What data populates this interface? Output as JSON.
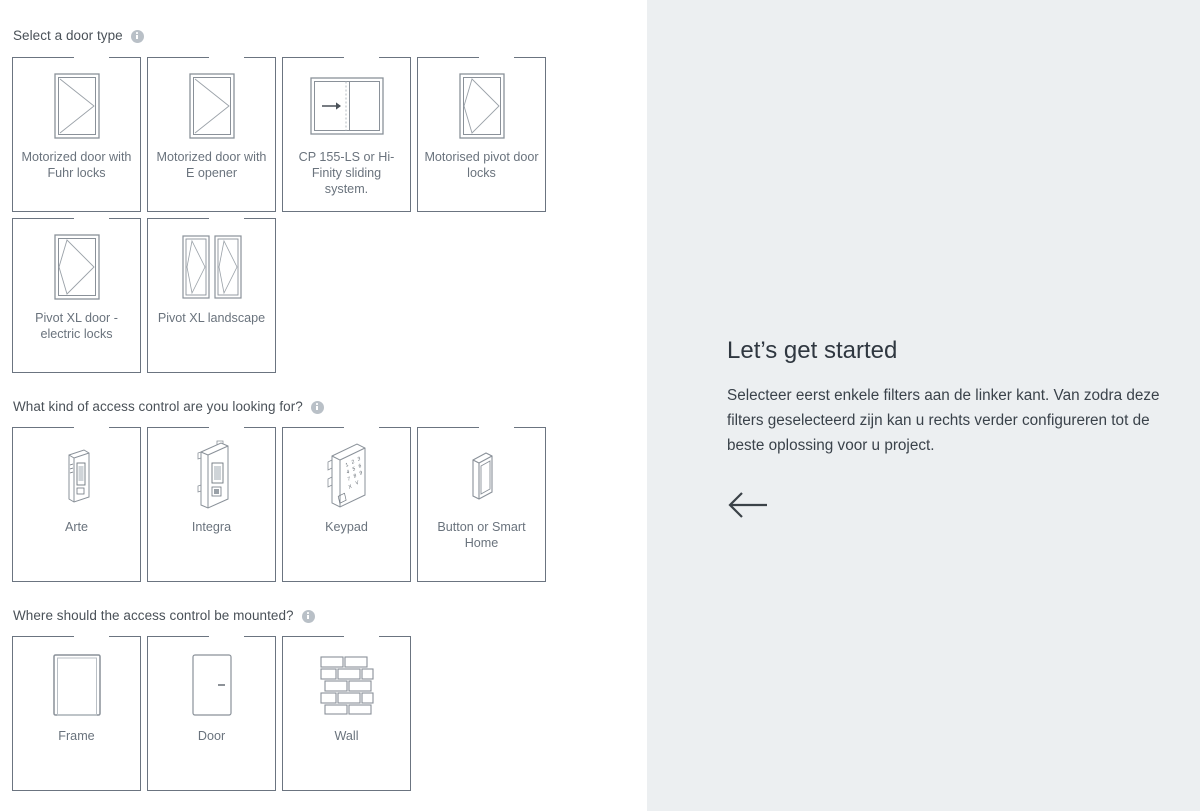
{
  "left_panel": {
    "sections": [
      {
        "id": "door-type",
        "heading": "Select a door type",
        "info_icon": "info-icon",
        "cards": [
          {
            "label": "Motorized door with Fuhr locks",
            "icon": "hinged-door-icon"
          },
          {
            "label": "Motorized door with E opener",
            "icon": "hinged-door-icon"
          },
          {
            "label": "CP 155-LS or Hi-Finity sliding system.",
            "icon": "sliding-door-icon"
          },
          {
            "label": "Motorised pivot door locks",
            "icon": "pivot-door-icon"
          },
          {
            "label": "Pivot XL door - electric locks",
            "icon": "pivot-door-icon"
          },
          {
            "label": "Pivot XL landscape",
            "icon": "pivot-door-landscape-icon"
          }
        ]
      },
      {
        "id": "access-control",
        "heading": "What kind of access control are you looking for?",
        "info_icon": "info-icon",
        "cards": [
          {
            "label": "Arte",
            "icon": "arte-reader-icon"
          },
          {
            "label": "Integra",
            "icon": "integra-reader-icon"
          },
          {
            "label": "Keypad",
            "icon": "keypad-icon"
          },
          {
            "label": "Button or Smart Home",
            "icon": "button-smarthome-icon"
          }
        ]
      },
      {
        "id": "mounting",
        "heading": "Where should the access control be mounted?",
        "info_icon": "info-icon",
        "cards": [
          {
            "label": "Frame",
            "icon": "frame-icon"
          },
          {
            "label": "Door",
            "icon": "door-icon"
          },
          {
            "label": "Wall",
            "icon": "brick-wall-icon"
          }
        ]
      }
    ]
  },
  "right_panel": {
    "title": "Let’s get started",
    "body": "Selecteer eerst enkele filters aan de linker kant. Van zodra deze filters geselecteerd zijn kan u rechts verder configureren tot de beste oplossing voor u project.",
    "arrow_icon": "arrow-left-icon",
    "background_color": "#eceff1"
  },
  "colors": {
    "card_border": "#6b7480",
    "card_label_text": "#6a737d",
    "heading_text": "#4a5158",
    "icon_stroke": "#7d858d",
    "info_icon_bg": "#b9c0c7",
    "right_panel_bg": "#eceff1",
    "right_panel_title": "#2f3740"
  }
}
